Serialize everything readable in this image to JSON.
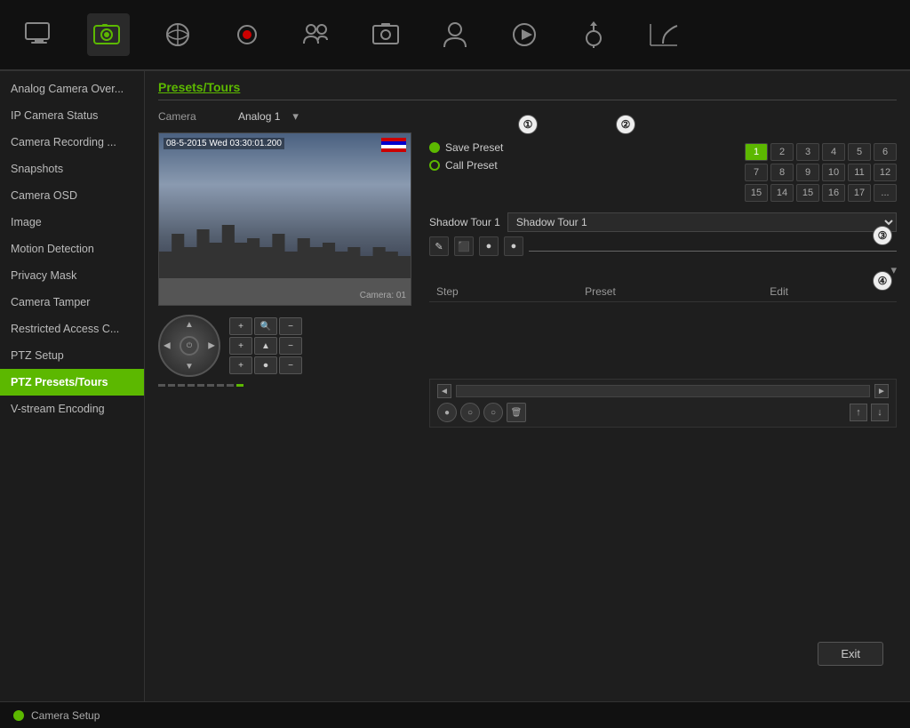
{
  "app": {
    "title": "Camera Setup"
  },
  "toolbar": {
    "icons": [
      {
        "name": "monitor-icon",
        "label": "Monitor"
      },
      {
        "name": "camera-icon",
        "label": "Camera"
      },
      {
        "name": "network-icon",
        "label": "Network"
      },
      {
        "name": "record-icon",
        "label": "Record"
      },
      {
        "name": "users-icon",
        "label": "Users"
      },
      {
        "name": "snapshot-icon",
        "label": "Snapshot"
      },
      {
        "name": "account-icon",
        "label": "Account"
      },
      {
        "name": "playback-icon",
        "label": "Playback"
      },
      {
        "name": "ptz-icon",
        "label": "PTZ"
      },
      {
        "name": "stats-icon",
        "label": "Stats"
      }
    ]
  },
  "sidebar": {
    "items": [
      {
        "label": "Analog Camera Over...",
        "active": false
      },
      {
        "label": "IP Camera Status",
        "active": false
      },
      {
        "label": "Camera Recording ...",
        "active": false
      },
      {
        "label": "Snapshots",
        "active": false
      },
      {
        "label": "Camera OSD",
        "active": false
      },
      {
        "label": "Image",
        "active": false
      },
      {
        "label": "Motion Detection",
        "active": false
      },
      {
        "label": "Privacy Mask",
        "active": false
      },
      {
        "label": "Camera Tamper",
        "active": false
      },
      {
        "label": "Restricted Access C...",
        "active": false
      },
      {
        "label": "PTZ Setup",
        "active": false
      },
      {
        "label": "PTZ Presets/Tours",
        "active": true
      },
      {
        "label": "V-stream Encoding",
        "active": false
      }
    ]
  },
  "page": {
    "title": "Presets/Tours",
    "camera_label": "Camera",
    "camera_value": "Analog 1"
  },
  "presets": {
    "save_label": "Save Preset",
    "call_label": "Call Preset",
    "numbers_row1": [
      "2",
      "3",
      "4",
      "5",
      "6"
    ],
    "numbers_row2": [
      "8",
      "9",
      "10",
      "11",
      "12"
    ],
    "numbers_row3": [
      "15",
      "14",
      "15",
      "16",
      "17",
      "..."
    ]
  },
  "shadow_tour": {
    "label": "Shadow Tour 1",
    "dropdown_value": "Shadow Tour 1"
  },
  "tour_controls": {
    "edit_icon": "✎",
    "save_icon": "💾",
    "play_icon": "●",
    "stop_icon": "●"
  },
  "step_table": {
    "col_step": "Step",
    "col_preset": "Preset",
    "col_edit": "Edit"
  },
  "playback": {
    "arrow_left": "◄",
    "arrow_right": "►"
  },
  "buttons": {
    "exit": "Exit"
  },
  "status": {
    "dot_color": "#5cb800",
    "label": "Camera Setup"
  },
  "annotations": [
    {
      "num": "①",
      "label": "1"
    },
    {
      "num": "②",
      "label": "2"
    },
    {
      "num": "③",
      "label": "3"
    },
    {
      "num": "④",
      "label": "4"
    }
  ]
}
